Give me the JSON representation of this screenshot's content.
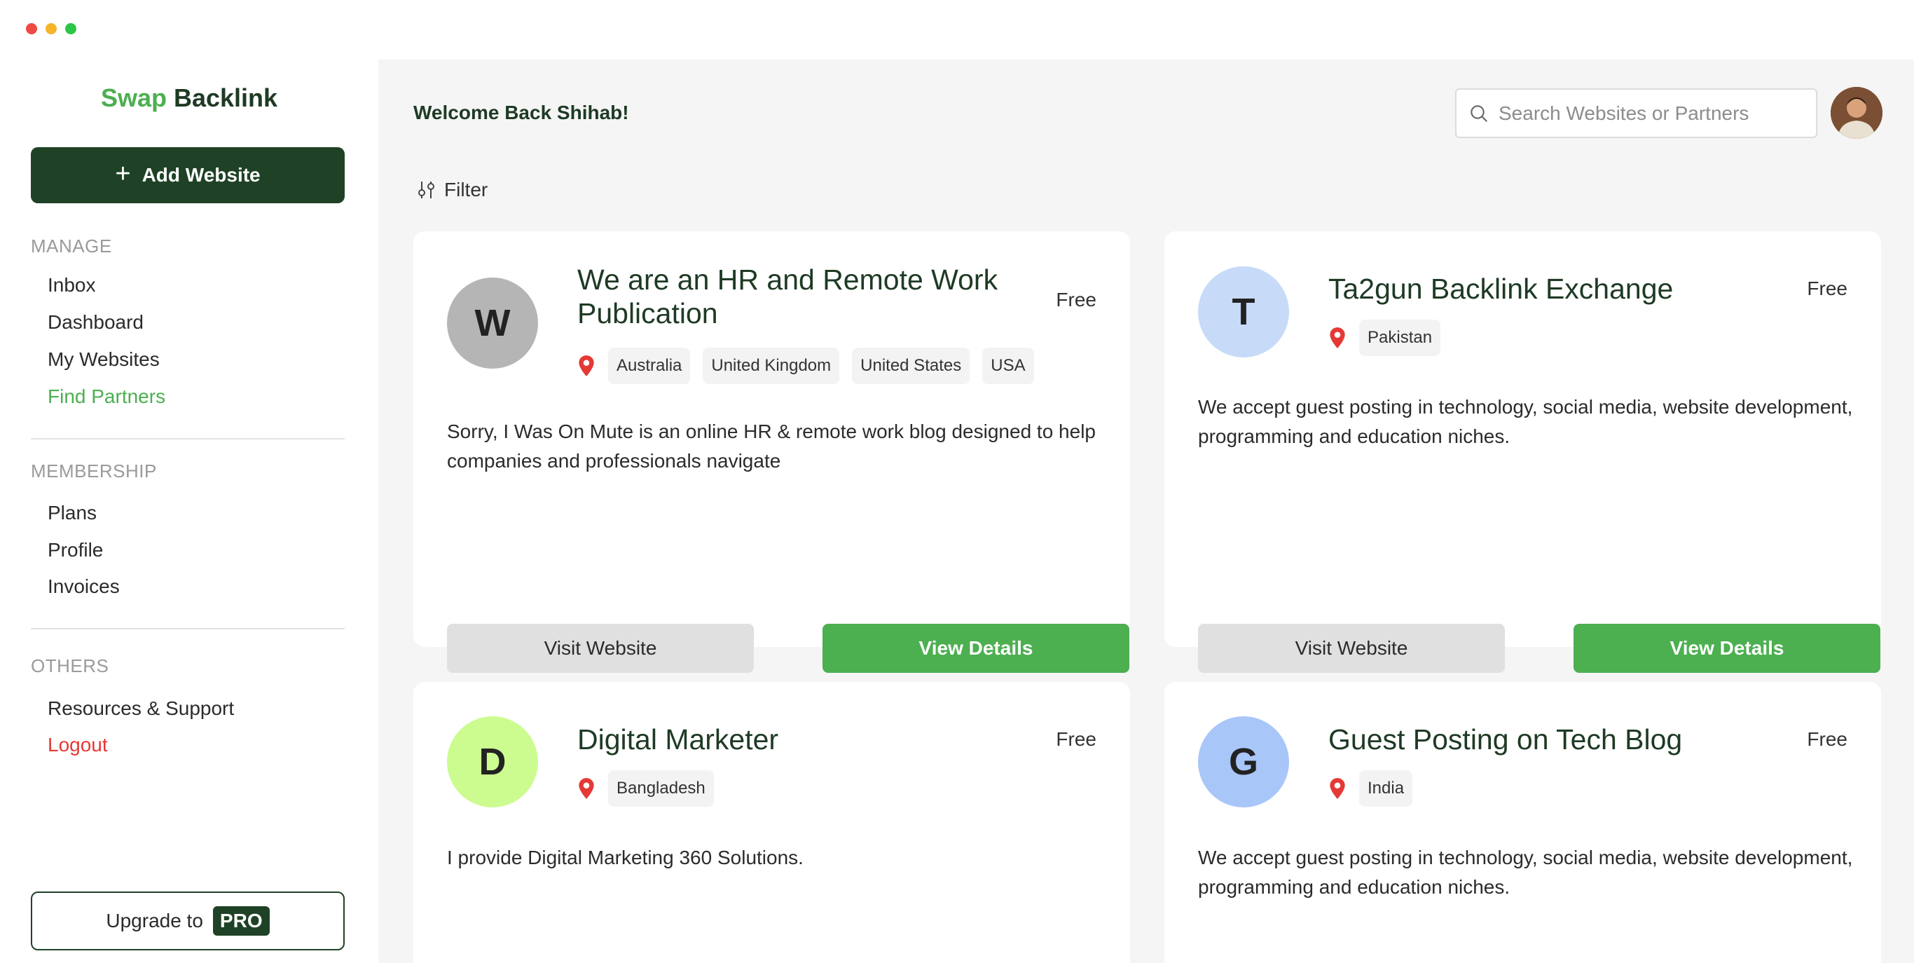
{
  "window_controls": {
    "close": "#ed4a44",
    "minimize": "#f6b42a",
    "maximize": "#2bc646"
  },
  "colors": {
    "brand_green": "#4caf50",
    "dark_green": "#1f4226",
    "logout_red": "#e53935"
  },
  "sidebar": {
    "logo": {
      "part1": "Swap",
      "part2": "Backlink"
    },
    "add_button": {
      "icon": "plus-icon",
      "label": "Add Website"
    },
    "sections": [
      {
        "title": "MANAGE",
        "items": [
          "Inbox",
          "Dashboard",
          "My Websites",
          "Find Partners"
        ]
      },
      {
        "title": "MEMBERSHIP",
        "items": [
          "Plans",
          "Profile",
          "Invoices"
        ]
      },
      {
        "title": "OTHERS",
        "items": [
          "Resources & Support",
          "Logout"
        ]
      }
    ],
    "active_item": "Find Partners",
    "upgrade": {
      "text": "Upgrade to",
      "badge": "PRO"
    }
  },
  "header": {
    "welcome": "Welcome Back Shihab!",
    "search": {
      "placeholder": "Search Websites or Partners",
      "icon": "search-icon"
    },
    "avatar": "user-avatar"
  },
  "filter": {
    "icon": "sliders-icon",
    "label": "Filter"
  },
  "cards": [
    {
      "letter": "W",
      "letter_bg": "#b5b5b5",
      "title": "We are an HR and Remote Work Publication",
      "price": "Free",
      "locations": [
        "Australia",
        "United Kingdom",
        "United States",
        "USA"
      ],
      "description": "Sorry, I Was On Mute is an online HR & remote work blog designed to help companies and professionals navigate",
      "visit_label": "Visit Website",
      "details_label": "View Details"
    },
    {
      "letter": "T",
      "letter_bg": "#c7daf8",
      "title": "Ta2gun Backlink Exchange",
      "price": "Free",
      "locations": [
        "Pakistan"
      ],
      "description": "We accept guest posting in technology, social media, website development, programming and education niches.",
      "visit_label": "Visit Website",
      "details_label": "View Details"
    },
    {
      "letter": "D",
      "letter_bg": "#ccfc90",
      "title": "Digital Marketer",
      "price": "Free",
      "locations": [
        "Bangladesh"
      ],
      "description": "I provide Digital Marketing 360 Solutions."
    },
    {
      "letter": "G",
      "letter_bg": "#a8c6f8",
      "title": "Guest Posting on Tech Blog",
      "price": "Free",
      "locations": [
        "India"
      ],
      "description": "We accept guest posting in technology, social media, website development, programming and education niches."
    }
  ]
}
